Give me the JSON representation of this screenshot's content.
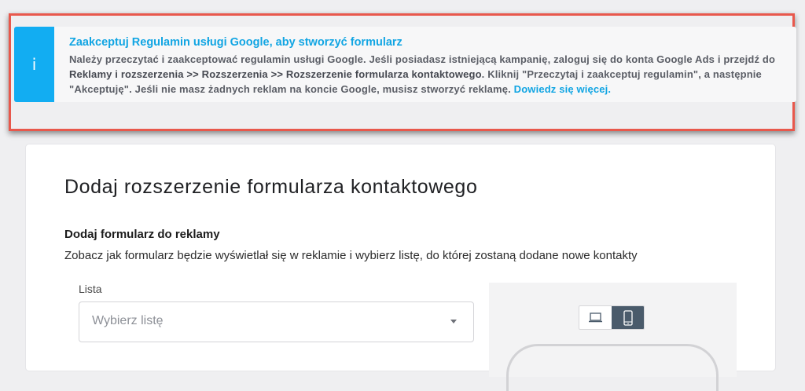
{
  "notice": {
    "icon_glyph": "i",
    "title": "Zaakceptuj Regulamin usługi Google, aby stworzyć formularz",
    "text_1": "Należy przeczytać i zaakceptować regulamin usługi Google. Jeśli posiadasz istniejącą kampanię, zaloguj się do konta Google Ads i przejdź do ",
    "text_strong": "Reklamy i rozszerzenia >> Rozszerzenia >> Rozszerzenie formularza kontaktowego",
    "text_2": ". Kliknij \"Przeczytaj i zaakceptuj regulamin\", a następnie \"Akceptuję\". Jeśli nie masz żadnych reklam na koncie Google, musisz stworzyć reklamę. ",
    "link_label": "Dowiedz się więcej."
  },
  "page": {
    "title": "Dodaj rozszerzenie formularza kontaktowego"
  },
  "section": {
    "title": "Dodaj formularz do reklamy",
    "description": "Zobacz jak formularz będzie wyświetlał się w reklamie i wybierz listę, do której zostaną dodane nowe kontakty"
  },
  "list_field": {
    "label": "Lista",
    "placeholder": "Wybierz listę"
  },
  "preview": {
    "devices": [
      {
        "icon": "laptop-icon",
        "active": false
      },
      {
        "icon": "mobile-icon",
        "active": true
      }
    ]
  },
  "colors": {
    "accent": "#12adf2",
    "highlight_border": "#e8584c",
    "active_toggle": "#4a5b6b"
  }
}
